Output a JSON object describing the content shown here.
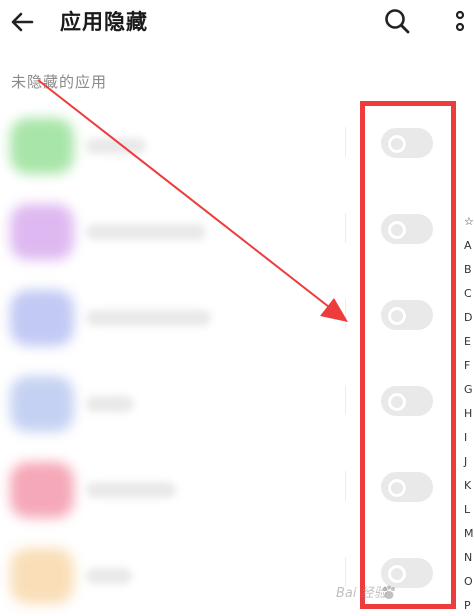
{
  "header": {
    "title": "应用隐藏",
    "back_icon": "arrow-left-icon",
    "search_icon": "search-icon",
    "more_icon": "more-vertical-icon"
  },
  "section": {
    "label": "未隐藏的应用"
  },
  "apps": [
    {
      "name": "",
      "icon_color": "#6fd46f",
      "hidden": false
    },
    {
      "name": "",
      "icon_color": "#c98be8",
      "hidden": false
    },
    {
      "name": "",
      "icon_color": "#9aa6ee",
      "hidden": false
    },
    {
      "name": "",
      "icon_color": "#9fb4ea",
      "hidden": false
    },
    {
      "name": "",
      "icon_color": "#ef6f8a",
      "hidden": false
    },
    {
      "name": "",
      "icon_color": "#f6c98a",
      "hidden": false
    }
  ],
  "alpha_index": [
    "☆",
    "A",
    "B",
    "C",
    "D",
    "E",
    "F",
    "G",
    "H",
    "I",
    "J",
    "K",
    "L",
    "M",
    "N",
    "O",
    "P"
  ],
  "annotation": {
    "box_color": "#ee3b3b",
    "arrow_color": "#ee3b3b"
  },
  "watermark": {
    "text": "Bai 经验"
  }
}
